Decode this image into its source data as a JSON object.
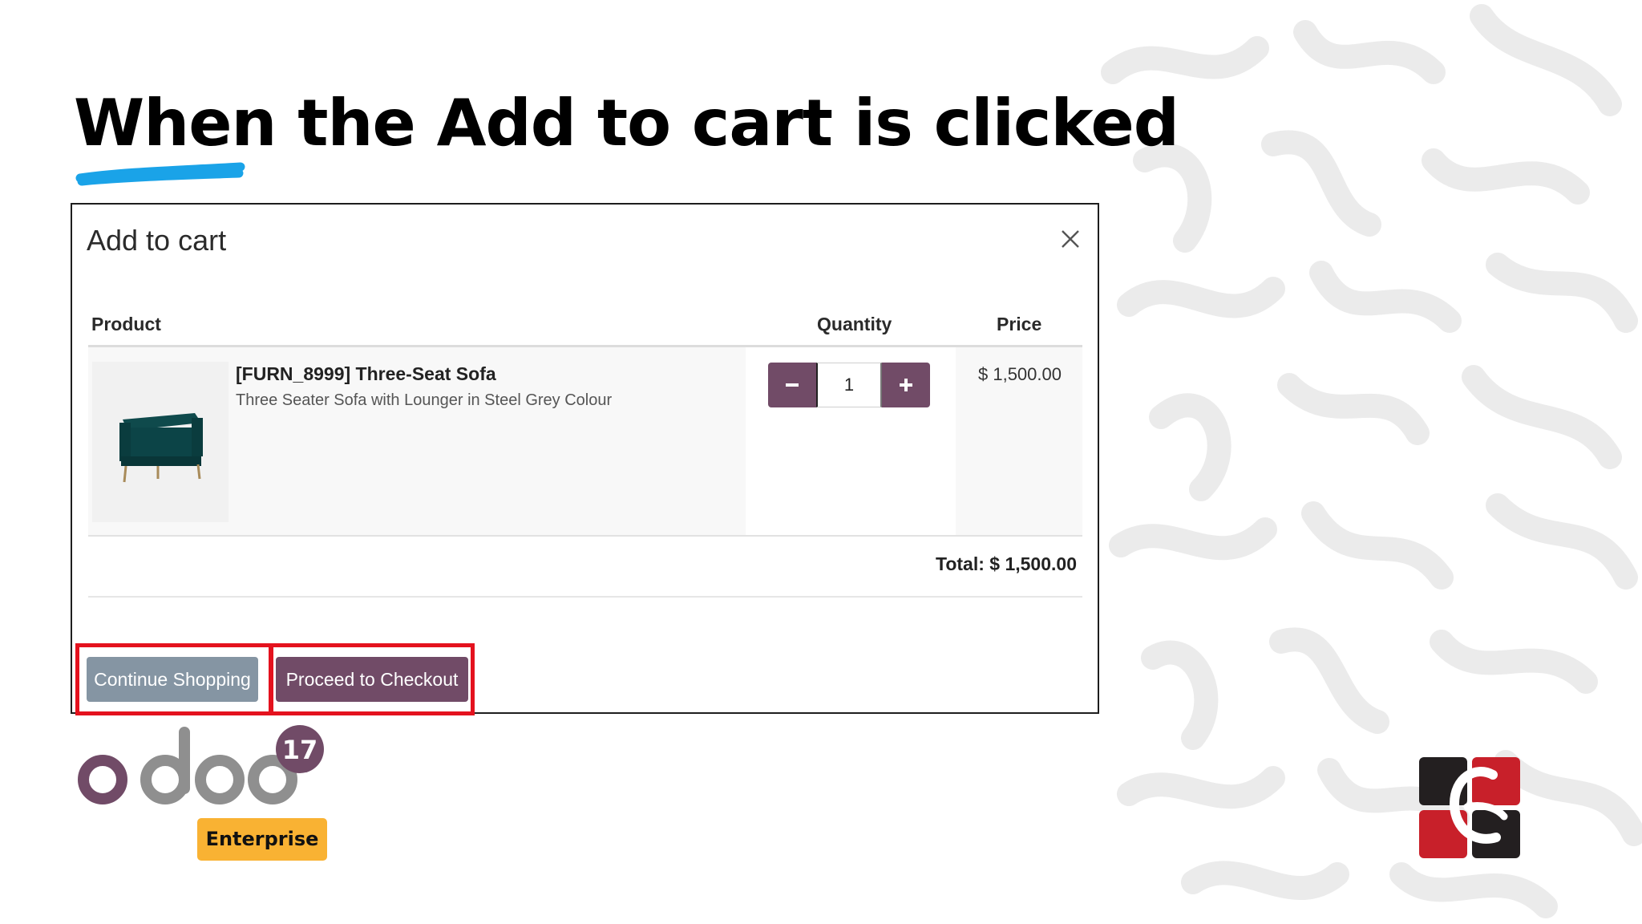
{
  "slide": {
    "title": "When the Add to cart is clicked"
  },
  "dialog": {
    "title": "Add to cart",
    "close_icon": "close-icon",
    "columns": {
      "product": "Product",
      "quantity": "Quantity",
      "price": "Price"
    },
    "item": {
      "name": "[FURN_8999] Three-Seat Sofa",
      "description": "Three Seater Sofa with Lounger in Steel Grey Colour",
      "quantity": "1",
      "price": "$ 1,500.00",
      "image_icon": "sofa-image"
    },
    "total": "Total: $ 1,500.00",
    "buttons": {
      "continue": "Continue Shopping",
      "checkout": "Proceed to Checkout"
    }
  },
  "branding": {
    "odoo_wordmark": "odoo",
    "version": "17",
    "edition": "Enterprise"
  },
  "colors": {
    "odoo_purple": "#714b67",
    "continue_button": "#8595a3",
    "highlight_red": "#e4121e",
    "enterprise_badge": "#f9b233",
    "title_underline": "#1aa3e8"
  }
}
